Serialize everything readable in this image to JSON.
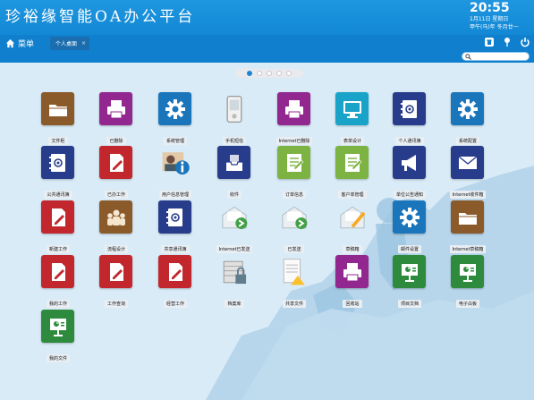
{
  "header": {
    "app_title": "珍裕缘智能OA办公平台",
    "time": "20:55",
    "date_line": "1月11日 星期日",
    "lunar_line": "甲午(马)年 冬月廿一"
  },
  "nav": {
    "menu_label": "菜单",
    "tab_label": "个人桌面",
    "tab_close": "×"
  },
  "search": {
    "placeholder": ""
  },
  "pager": {
    "pages": 5,
    "current": 1
  },
  "colors": {
    "brown": "#8b5a2b",
    "purple": "#92278f",
    "blue": "#1b75bb",
    "teal": "#1aa3c9",
    "navy": "#283c8c",
    "red": "#c1272d",
    "green": "#7cb342",
    "darkgreen": "#2e8b3e",
    "orange": "#d35400"
  },
  "apps": [
    {
      "label": "文件柜",
      "color": "brown",
      "icon": "folder"
    },
    {
      "label": "已删除",
      "color": "purple",
      "icon": "printer"
    },
    {
      "label": "系统管理",
      "color": "blue",
      "icon": "gear"
    },
    {
      "label": "手机短信",
      "color": "none",
      "icon": "phone"
    },
    {
      "label": "Internet已删除",
      "color": "purple",
      "icon": "printer"
    },
    {
      "label": "表单设计",
      "color": "teal",
      "icon": "monitor"
    },
    {
      "label": "个人通讯簿",
      "color": "navy",
      "icon": "addressbook"
    },
    {
      "label": "系统配置",
      "color": "blue",
      "icon": "gear"
    },
    {
      "label": "公共通讯簿",
      "color": "navy",
      "icon": "addressbook"
    },
    {
      "label": "已办工作",
      "color": "red",
      "icon": "doc-edit"
    },
    {
      "label": "用户信息管理",
      "color": "none",
      "icon": "user-info"
    },
    {
      "label": "收件",
      "color": "navy",
      "icon": "inbox"
    },
    {
      "label": "订单信息",
      "color": "green",
      "icon": "checklist"
    },
    {
      "label": "客户单管理",
      "color": "green",
      "icon": "checklist"
    },
    {
      "label": "单位公告通知",
      "color": "navy",
      "icon": "megaphone"
    },
    {
      "label": "Internet收件箱",
      "color": "navy",
      "icon": "mail"
    },
    {
      "label": "新建工作",
      "color": "red",
      "icon": "doc-edit"
    },
    {
      "label": "流程设计",
      "color": "brown",
      "icon": "people"
    },
    {
      "label": "共享通讯簿",
      "color": "navy",
      "icon": "addressbook"
    },
    {
      "label": "Internet已发送",
      "color": "none",
      "icon": "mail-open"
    },
    {
      "label": "已发送",
      "color": "none",
      "icon": "mail-open"
    },
    {
      "label": "草稿箱",
      "color": "none",
      "icon": "mail-draft"
    },
    {
      "label": "邮件设置",
      "color": "blue",
      "icon": "gear"
    },
    {
      "label": "Internet草稿箱",
      "color": "brown",
      "icon": "folder"
    },
    {
      "label": "我的工作",
      "color": "red",
      "icon": "doc-edit"
    },
    {
      "label": "工作查询",
      "color": "red",
      "icon": "doc-edit"
    },
    {
      "label": "经营工作",
      "color": "red",
      "icon": "doc-edit"
    },
    {
      "label": "档案库",
      "color": "none",
      "icon": "archive-lock"
    },
    {
      "label": "共享文件",
      "color": "none",
      "icon": "shared-file"
    },
    {
      "label": "回收站",
      "color": "purple",
      "icon": "printer"
    },
    {
      "label": "项目文档",
      "color": "darkgreen",
      "icon": "presentation"
    },
    {
      "label": "电子白板",
      "color": "darkgreen",
      "icon": "presentation"
    },
    {
      "label": "我的文件",
      "color": "darkgreen",
      "icon": "presentation"
    }
  ]
}
